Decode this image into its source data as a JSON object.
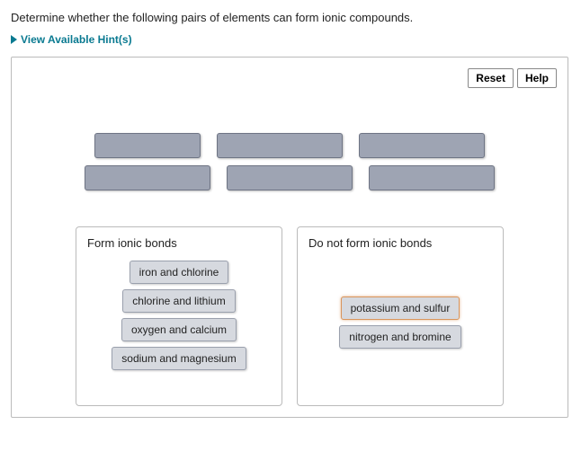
{
  "question": "Determine whether the following pairs of elements can form ionic compounds.",
  "hints_label": "View Available Hint(s)",
  "toolbar": {
    "reset_label": "Reset",
    "help_label": "Help"
  },
  "bins": {
    "left": {
      "title": "Form ionic bonds"
    },
    "right": {
      "title": "Do not form ionic bonds"
    }
  },
  "items": {
    "left": [
      "iron and chlorine",
      "chlorine and lithium",
      "oxygen and calcium",
      "sodium and magnesium"
    ],
    "right": [
      "potassium and sulfur",
      "nitrogen and bromine"
    ]
  }
}
